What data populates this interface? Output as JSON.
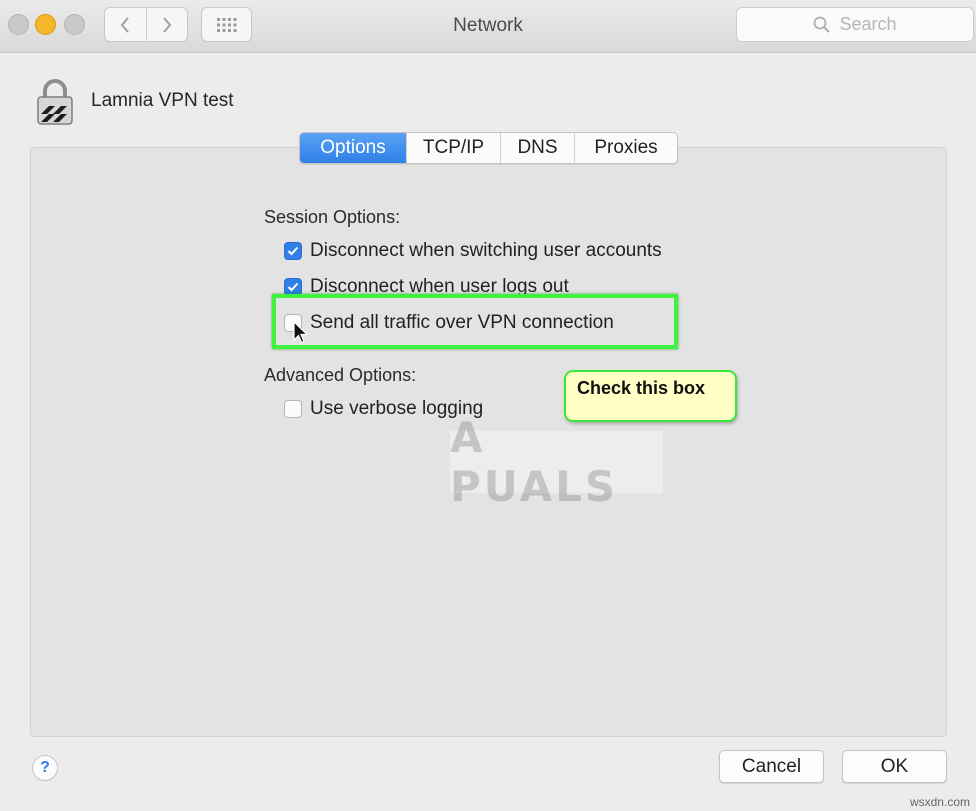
{
  "window": {
    "title": "Network"
  },
  "search": {
    "placeholder": "Search"
  },
  "connection": {
    "name": "Lamnia VPN test"
  },
  "tabs": [
    {
      "label": "Options",
      "active": true
    },
    {
      "label": "TCP/IP",
      "active": false
    },
    {
      "label": "DNS",
      "active": false
    },
    {
      "label": "Proxies",
      "active": false
    }
  ],
  "session": {
    "label": "Session Options:",
    "options": [
      {
        "label": "Disconnect when switching user accounts",
        "checked": true
      },
      {
        "label": "Disconnect when user logs out",
        "checked": true
      },
      {
        "label": "Send all traffic over VPN connection",
        "checked": false
      }
    ]
  },
  "advanced": {
    "label": "Advanced Options:",
    "options": [
      {
        "label": "Use verbose logging",
        "checked": false
      }
    ]
  },
  "annotation": {
    "callout": "Check this box",
    "highlight_color": "#3ff23f"
  },
  "watermark": {
    "text": "A  PUALS"
  },
  "buttons": {
    "help": "?",
    "cancel": "Cancel",
    "ok": "OK"
  },
  "credit": "wsxdn.com",
  "colors": {
    "accent": "#2f7fe6",
    "callout_bg": "#ffffc6"
  },
  "icons": [
    "back-chevron-icon",
    "forward-chevron-icon",
    "grid-icon",
    "magnifier-icon",
    "lock-icon",
    "checkmark-icon",
    "cursor-icon"
  ]
}
